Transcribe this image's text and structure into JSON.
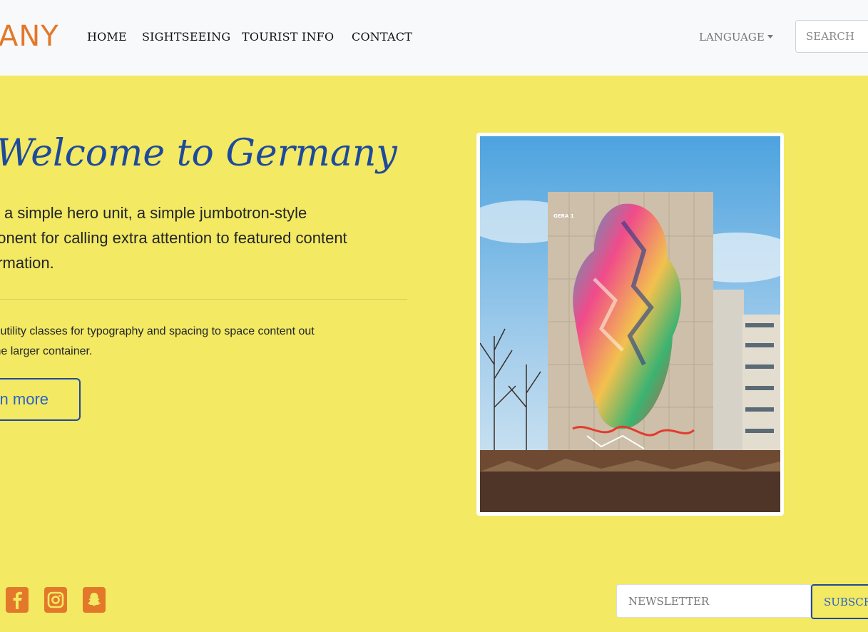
{
  "navbar": {
    "brand": "ANY",
    "links": [
      "HOME",
      "SIGHTSEEING",
      "TOURIST INFO",
      "CONTACT"
    ],
    "language_label": "LANGUAGE",
    "search_placeholder": "SEARCH"
  },
  "hero": {
    "title": "Welcome to Germany",
    "lead": "is a simple hero unit, a simple jumbotron-style\nponent for calling extra attention to featured content\normation.",
    "paragraph": "s utility classes for typography and spacing to space content out\nthe larger container.",
    "button_label": "arn more",
    "image_caption": "GERA 1"
  },
  "footer": {
    "social_icons": [
      "facebook-icon",
      "instagram-icon",
      "snapchat-icon"
    ],
    "newsletter_placeholder": "NEWSLETTER",
    "subscribe_label": "SUBSCRIBE"
  },
  "colors": {
    "background": "#f3e962",
    "navbar": "#f8f9fa",
    "brand": "#e3782a",
    "accent_blue": "#1e4a9c"
  }
}
